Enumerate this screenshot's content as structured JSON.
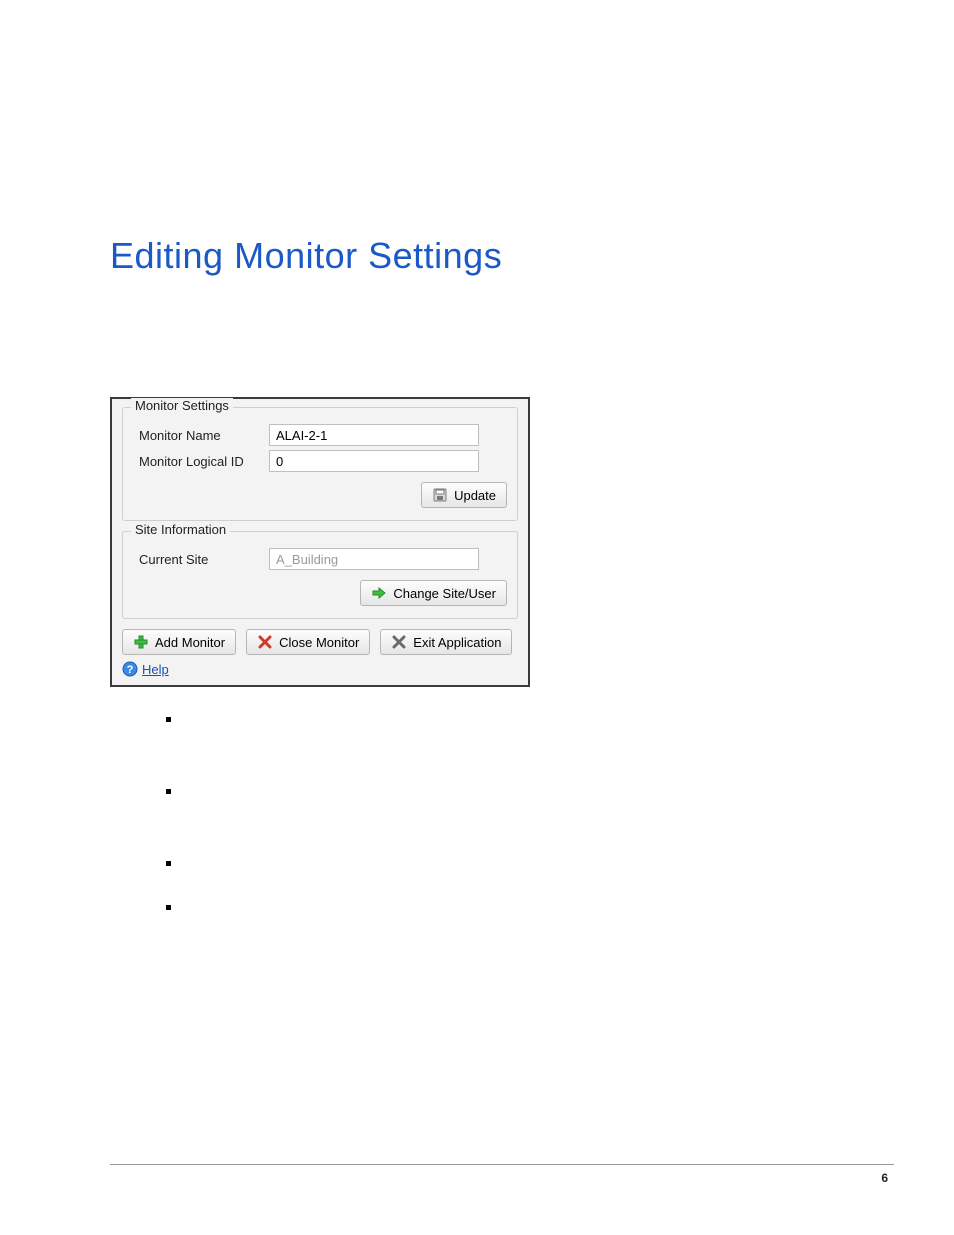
{
  "heading": "Editing Monitor Settings",
  "panel": {
    "monitor_settings": {
      "legend": "Monitor Settings",
      "name_label": "Monitor Name",
      "name_value": "ALAI-2-1",
      "logical_id_label": "Monitor Logical ID",
      "logical_id_value": "0",
      "update_label": "Update"
    },
    "site_info": {
      "legend": "Site Information",
      "current_site_label": "Current Site",
      "current_site_value": "A_Building",
      "change_site_label": "Change Site/User"
    },
    "actions": {
      "add_monitor": "Add Monitor",
      "close_monitor": "Close Monitor",
      "exit_application": "Exit Application",
      "help": "Help"
    }
  },
  "page_number": "6"
}
